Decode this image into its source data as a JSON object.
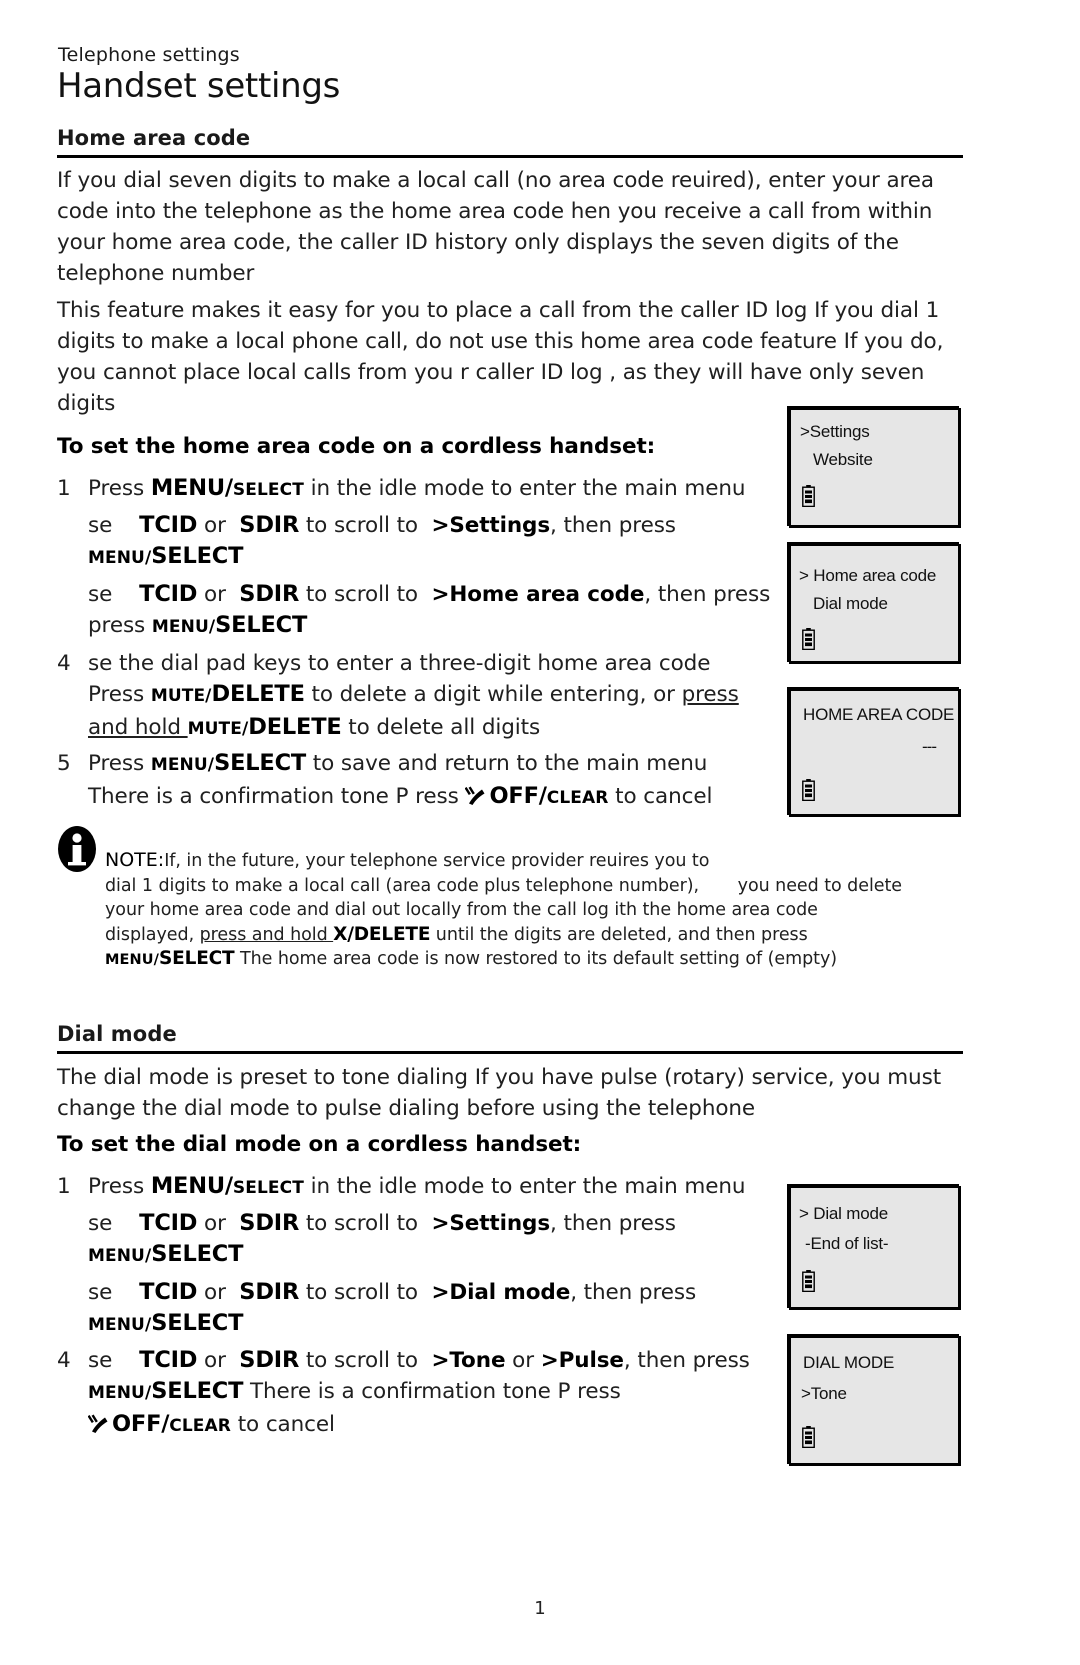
{
  "header": {
    "kicker": "Telephone settings",
    "title": "Handset settings"
  },
  "sections": [
    {
      "id": "home-area-code",
      "title": "Home area code",
      "paragraphs": [
        "If you dial seven digits to make a local call (no area code reuired), enter your area code into the telephone as the home area code hen you receive a call from within your home area code, the caller ID history only displays the seven digits of the telephone number",
        "This feature makes it easy for you to place a call from the caller ID log If you dial 1 digits to make a local phone call, do not use this home area code feature If you do, you cannot place    local calls from you r caller ID log , as they will have only seven digits"
      ],
      "subhead": "To set the home area code on a cordless handset:"
    },
    {
      "id": "dial-mode",
      "title": "Dial mode",
      "paragraphs": [
        "The dial mode is preset to tone dialing If you have pulse (rotary) service, you must change the dial mode to pulse dialing before using the telephone"
      ],
      "subhead": "To set the dial mode on a cordless handset:"
    }
  ],
  "steps_home": {
    "s1_num": "1",
    "s1_a_pre": "Press ",
    "s1_a_key_big": "MENU/",
    "s1_a_key_small": "SELECT",
    "s1_a_post": " in the idle mode to enter the main menu",
    "s2_pre": "se ",
    "s2_arrow_up": "T",
    "s2_cid": "CID",
    "s2_or": " or ",
    "s2_arrow_dn": "S",
    "s2_dir": "DIR",
    "s2_mid": " to scroll to ",
    "s2_target": ">Settings",
    "s2_tail": ", then press ",
    "s2_key_small": "MENU/",
    "s2_key_big": "SELECT",
    "s3_mid": " to scroll to ",
    "s3_target": ">Home area code",
    "s3_tail": ", then press ",
    "s3_press": "press ",
    "s4_num": "4",
    "s4_l1": "se the dial pad keys to enter a three-digit home area code Press ",
    "s4_mute_small": "MUTE/",
    "s4_mute_big": "DELETE",
    "s4_l2": " to delete a digit while entering, or ",
    "s4_hold": "press and hold ",
    "s4_l3": " to delete all digits",
    "s5_num": "5",
    "s5_pre": "Press ",
    "s5_key_small": "MENU/",
    "s5_key_big": "SELECT",
    "s5_post": " to save and return to the main menu",
    "s5_l2_pre": "There is a confirmation tone P   ress ",
    "s5_off_big": "OFF/",
    "s5_off_small": "CLEAR",
    "s5_l2_post": " to  cancel"
  },
  "steps_dial": {
    "s1_num": "1",
    "s1_pre": "Press ",
    "s1_key_big": "MENU/",
    "s1_key_small": "SELECT",
    "s1_post": " in the idle mode to enter the main menu",
    "s2_pre": "se ",
    "arrow_up": "T",
    "cid": "CID",
    "or": " or ",
    "arrow_dn": "S",
    "dir": "DIR",
    "s2_mid": " to scroll to ",
    "s2_target": ">Settings",
    "s2_tail": ", then press ",
    "key_small": "MENU/",
    "key_big": "SELECT",
    "s3_mid": " to scroll to ",
    "s3_target": ">Dial mode",
    "s3_tail": ", then press ",
    "s4_num": "4",
    "s4_pre": "se ",
    "s4_mid": " to scroll to ",
    "s4_tone": ">Tone",
    "s4_or": " or ",
    "s4_pulse": ">Pulse",
    "s4_tail": ", then press ",
    "s4_l2_post": " There is a confirmation tone P     ress",
    "s4_off_big": "OFF/",
    "s4_off_small": "CLEAR",
    "s4_l3_post": " to cancel"
  },
  "note": {
    "icon": "info-icon",
    "lead": "NOTE:",
    "line1": "If, in the future, your telephone service provider reuires you to",
    "line2a": "dial 1 digits to make a local call (area code plus telephone number),",
    "line2b": "you need to delete",
    "line3": "your home area code   and dial out locally from the call log    ith the home area code",
    "line4a": "displayed, ",
    "line4_hold": "press and hold ",
    "line4_key": "X/DELETE",
    "line4b": " until the digits are deleted, and then press",
    "line5_key_small": "MENU/",
    "line5_key_big": "SELECT",
    "line5b": " The home area code is now restored to its default setting of   (empty)"
  },
  "lcd_screens": [
    {
      "id": "lcd-settings",
      "line1": ">Settings",
      "line2": "Website",
      "battery": "battery-icon"
    },
    {
      "id": "lcd-home-area-code",
      "line1": "> Home area code",
      "line2": "Dial mode",
      "battery": "battery-icon"
    },
    {
      "id": "lcd-home-area-code-entry",
      "line1": "HOME AREA CODE",
      "dashes": "---",
      "battery": "battery-icon"
    },
    {
      "id": "lcd-dial-mode",
      "line1": "> Dial mode",
      "line2": "-End of list-",
      "battery": "battery-icon"
    },
    {
      "id": "lcd-dial-mode-tone",
      "line1": "DIAL MODE",
      "line2": ">Tone",
      "battery": "battery-icon"
    }
  ],
  "footer": {
    "page_number": "1"
  }
}
